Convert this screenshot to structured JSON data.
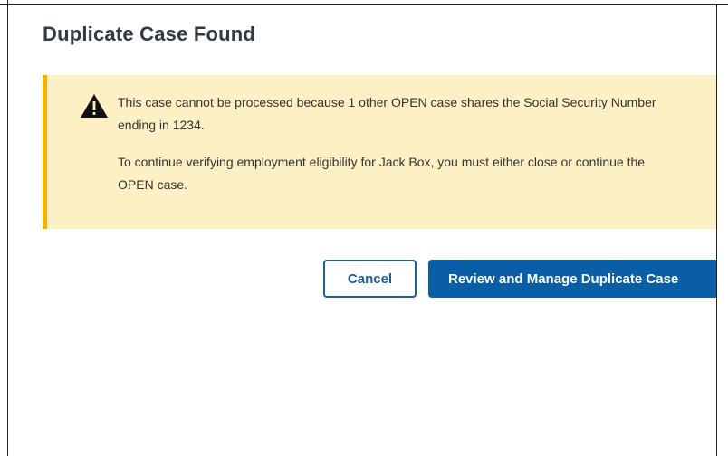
{
  "dialog": {
    "title": "Duplicate Case Found",
    "alert": {
      "icon": "warning-triangle-icon",
      "message_1": "This case cannot be processed because 1 other OPEN case shares the Social Security Number ending in 1234.",
      "message_2": "To continue verifying employment eligibility for Jack Box, you must either close or continue the OPEN case."
    },
    "buttons": {
      "cancel_label": "Cancel",
      "primary_label": "Review and Manage Duplicate Case"
    }
  },
  "colors": {
    "alert_background": "#fdf0c4",
    "alert_border": "#f5b300",
    "primary_button": "#0a5ea6",
    "title_text": "#2f3a45"
  }
}
